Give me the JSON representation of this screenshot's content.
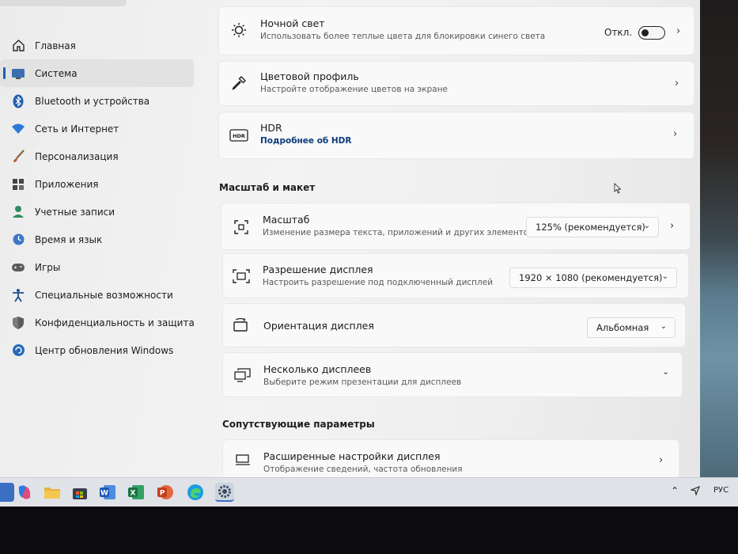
{
  "sidebar": {
    "items": [
      {
        "label": "Главная",
        "icon": "home-icon"
      },
      {
        "label": "Система",
        "icon": "system-icon",
        "active": true
      },
      {
        "label": "Bluetooth и устройства",
        "icon": "bluetooth-icon"
      },
      {
        "label": "Сеть и Интернет",
        "icon": "wifi-icon"
      },
      {
        "label": "Персонализация",
        "icon": "brush-icon"
      },
      {
        "label": "Приложения",
        "icon": "apps-icon"
      },
      {
        "label": "Учетные записи",
        "icon": "account-icon"
      },
      {
        "label": "Время и язык",
        "icon": "globe-clock-icon"
      },
      {
        "label": "Игры",
        "icon": "gamepad-icon"
      },
      {
        "label": "Специальные возможности",
        "icon": "accessibility-icon"
      },
      {
        "label": "Конфиденциальность и защита",
        "icon": "shield-icon"
      },
      {
        "label": "Центр обновления Windows",
        "icon": "update-icon"
      }
    ]
  },
  "main": {
    "night_light": {
      "title": "Ночной свет",
      "subtitle": "Использовать более теплые цвета для блокировки синего света",
      "toggle_label": "Откл.",
      "toggle_on": false
    },
    "color_profile": {
      "title": "Цветовой профиль",
      "subtitle": "Настройте отображение цветов на экране"
    },
    "hdr": {
      "title": "HDR",
      "link": "Подробнее об HDR",
      "icon_text": "HDR"
    },
    "scale_section": "Масштаб и макет",
    "scale": {
      "title": "Масштаб",
      "subtitle": "Изменение размера текста, приложений и других элементов",
      "value": "125% (рекомендуется)"
    },
    "resolution": {
      "title": "Разрешение дисплея",
      "subtitle": "Настроить разрешение под подключенный дисплей",
      "value": "1920 × 1080 (рекомендуется)"
    },
    "orientation": {
      "title": "Ориентация дисплея",
      "value": "Альбомная"
    },
    "multi": {
      "title": "Несколько дисплеев",
      "subtitle": "Выберите режим презентации для дисплеев"
    },
    "related_section": "Сопутствующие параметры",
    "advanced": {
      "title": "Расширенные настройки дисплея",
      "subtitle": "Отображение сведений, частота обновления"
    }
  },
  "taskbar": {
    "apps": [
      "copilot-icon",
      "file-explorer-icon",
      "store-icon",
      "word-icon",
      "excel-icon",
      "powerpoint-icon",
      "edge-icon",
      "settings-icon"
    ],
    "tray_lang": "РУС"
  },
  "colors": {
    "accent": "#1a5fb4",
    "background": "#f3f3f3",
    "card": "#f9f9f9"
  }
}
